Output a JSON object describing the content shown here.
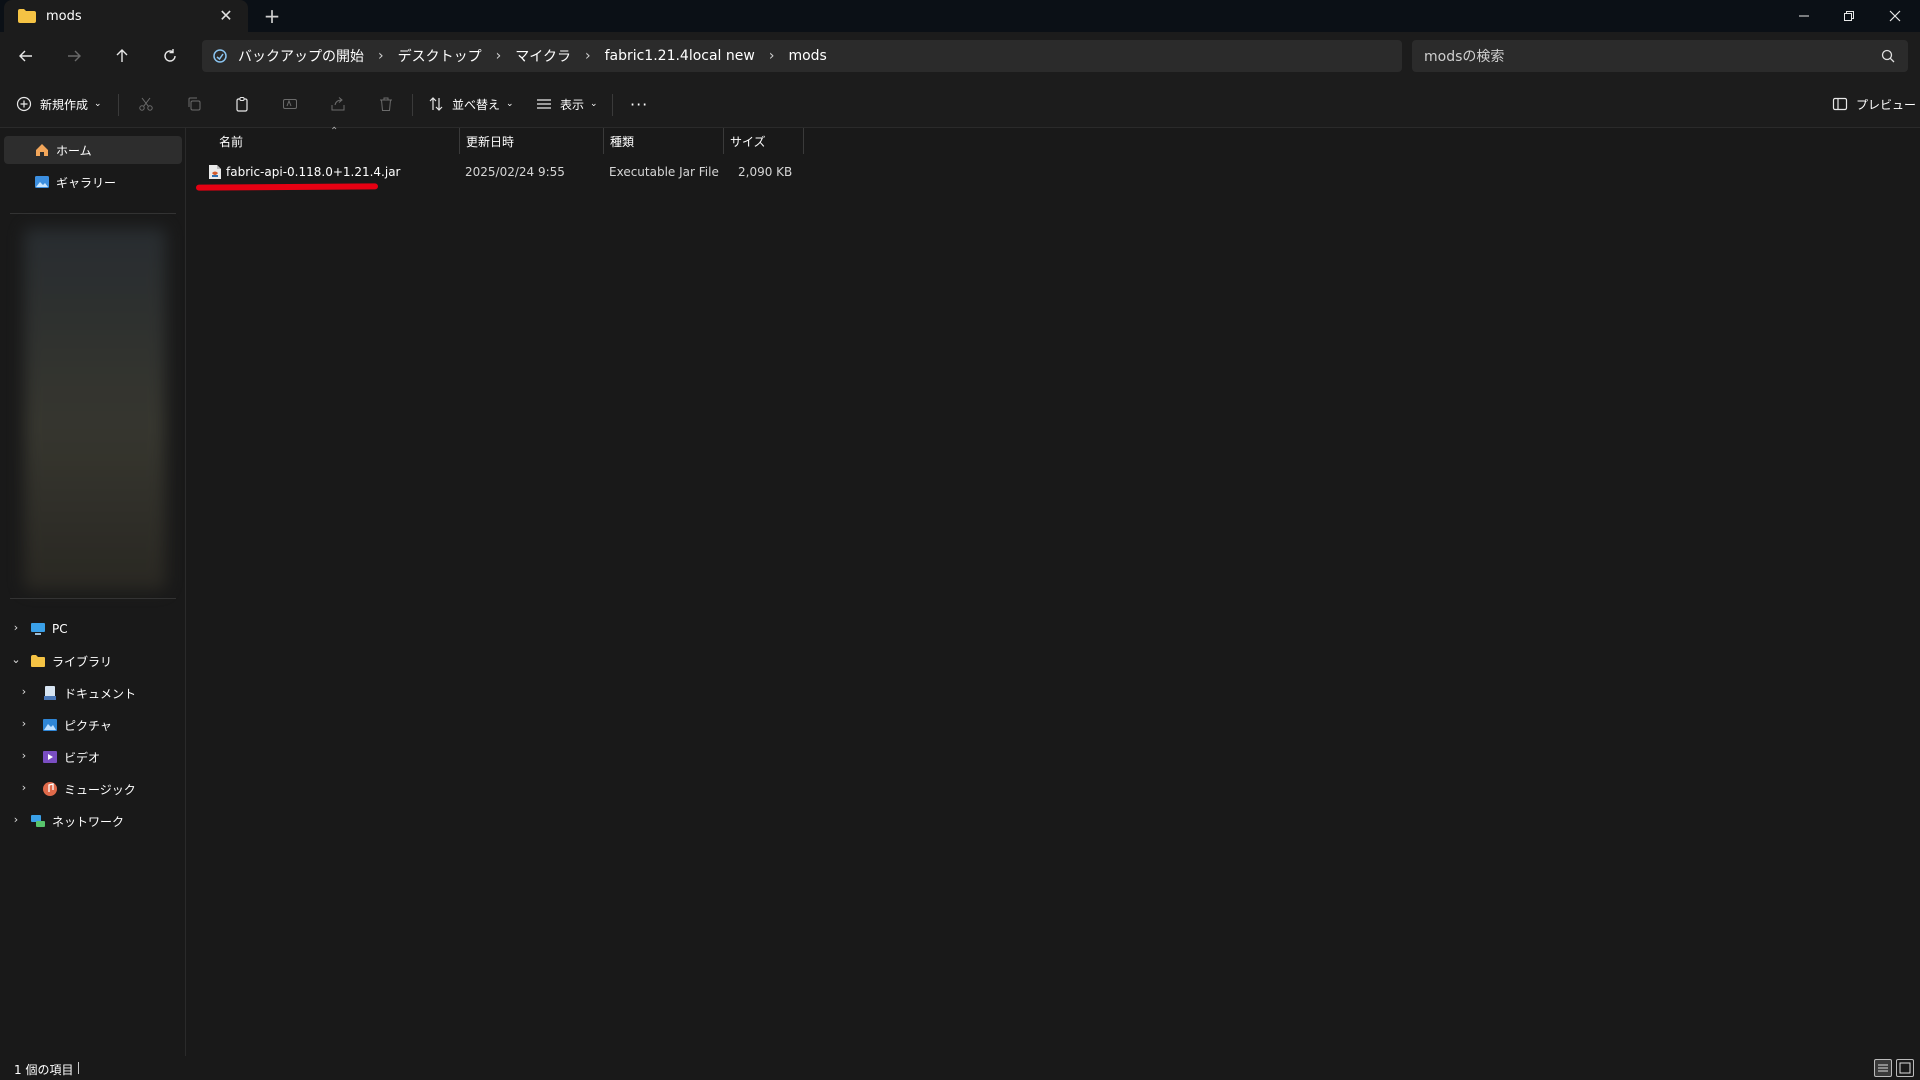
{
  "window": {
    "tab_title": "mods",
    "new_tab": "+",
    "controls": {
      "minimize": "─",
      "maximize": "❐",
      "close": "✕"
    }
  },
  "nav": {
    "breadcrumbs": [
      "バックアップの開始",
      "デスクトップ",
      "マイクラ",
      "fabric1.21.4local new",
      "mods"
    ],
    "search_placeholder": "modsの検索"
  },
  "toolbar": {
    "new_label": "新規作成",
    "sort_label": "並べ替え",
    "view_label": "表示",
    "more_label": "···",
    "preview_label": "プレビュー"
  },
  "sidebar": {
    "quick": [
      {
        "label": "ホーム",
        "icon": "home-icon"
      },
      {
        "label": "ギャラリー",
        "icon": "gallery-icon"
      }
    ],
    "tree": [
      {
        "label": "PC",
        "icon": "pc-icon",
        "expander": "›"
      },
      {
        "label": "ライブラリ",
        "icon": "folder-icon",
        "expander": "⌄"
      },
      {
        "label": "ドキュメント",
        "icon": "documents-icon",
        "expander": "›"
      },
      {
        "label": "ピクチャ",
        "icon": "pictures-icon",
        "expander": "›"
      },
      {
        "label": "ビデオ",
        "icon": "videos-icon",
        "expander": "›"
      },
      {
        "label": "ミュージック",
        "icon": "music-icon",
        "expander": "›"
      },
      {
        "label": "ネットワーク",
        "icon": "network-icon",
        "expander": "›"
      }
    ]
  },
  "columns": {
    "name": "名前",
    "modified": "更新日時",
    "type": "種類",
    "size": "サイズ"
  },
  "files": [
    {
      "name": "fabric-api-0.118.0+1.21.4.jar",
      "modified": "2025/02/24 9:55",
      "type": "Executable Jar File",
      "size": "2,090 KB"
    }
  ],
  "status": {
    "item_count": "1 個の項目"
  },
  "colors": {
    "background": "#191919",
    "titlebar": "#0b1016",
    "selection": "#2d2d2d",
    "annotation": "#e60012",
    "folder": "#f5c344"
  }
}
